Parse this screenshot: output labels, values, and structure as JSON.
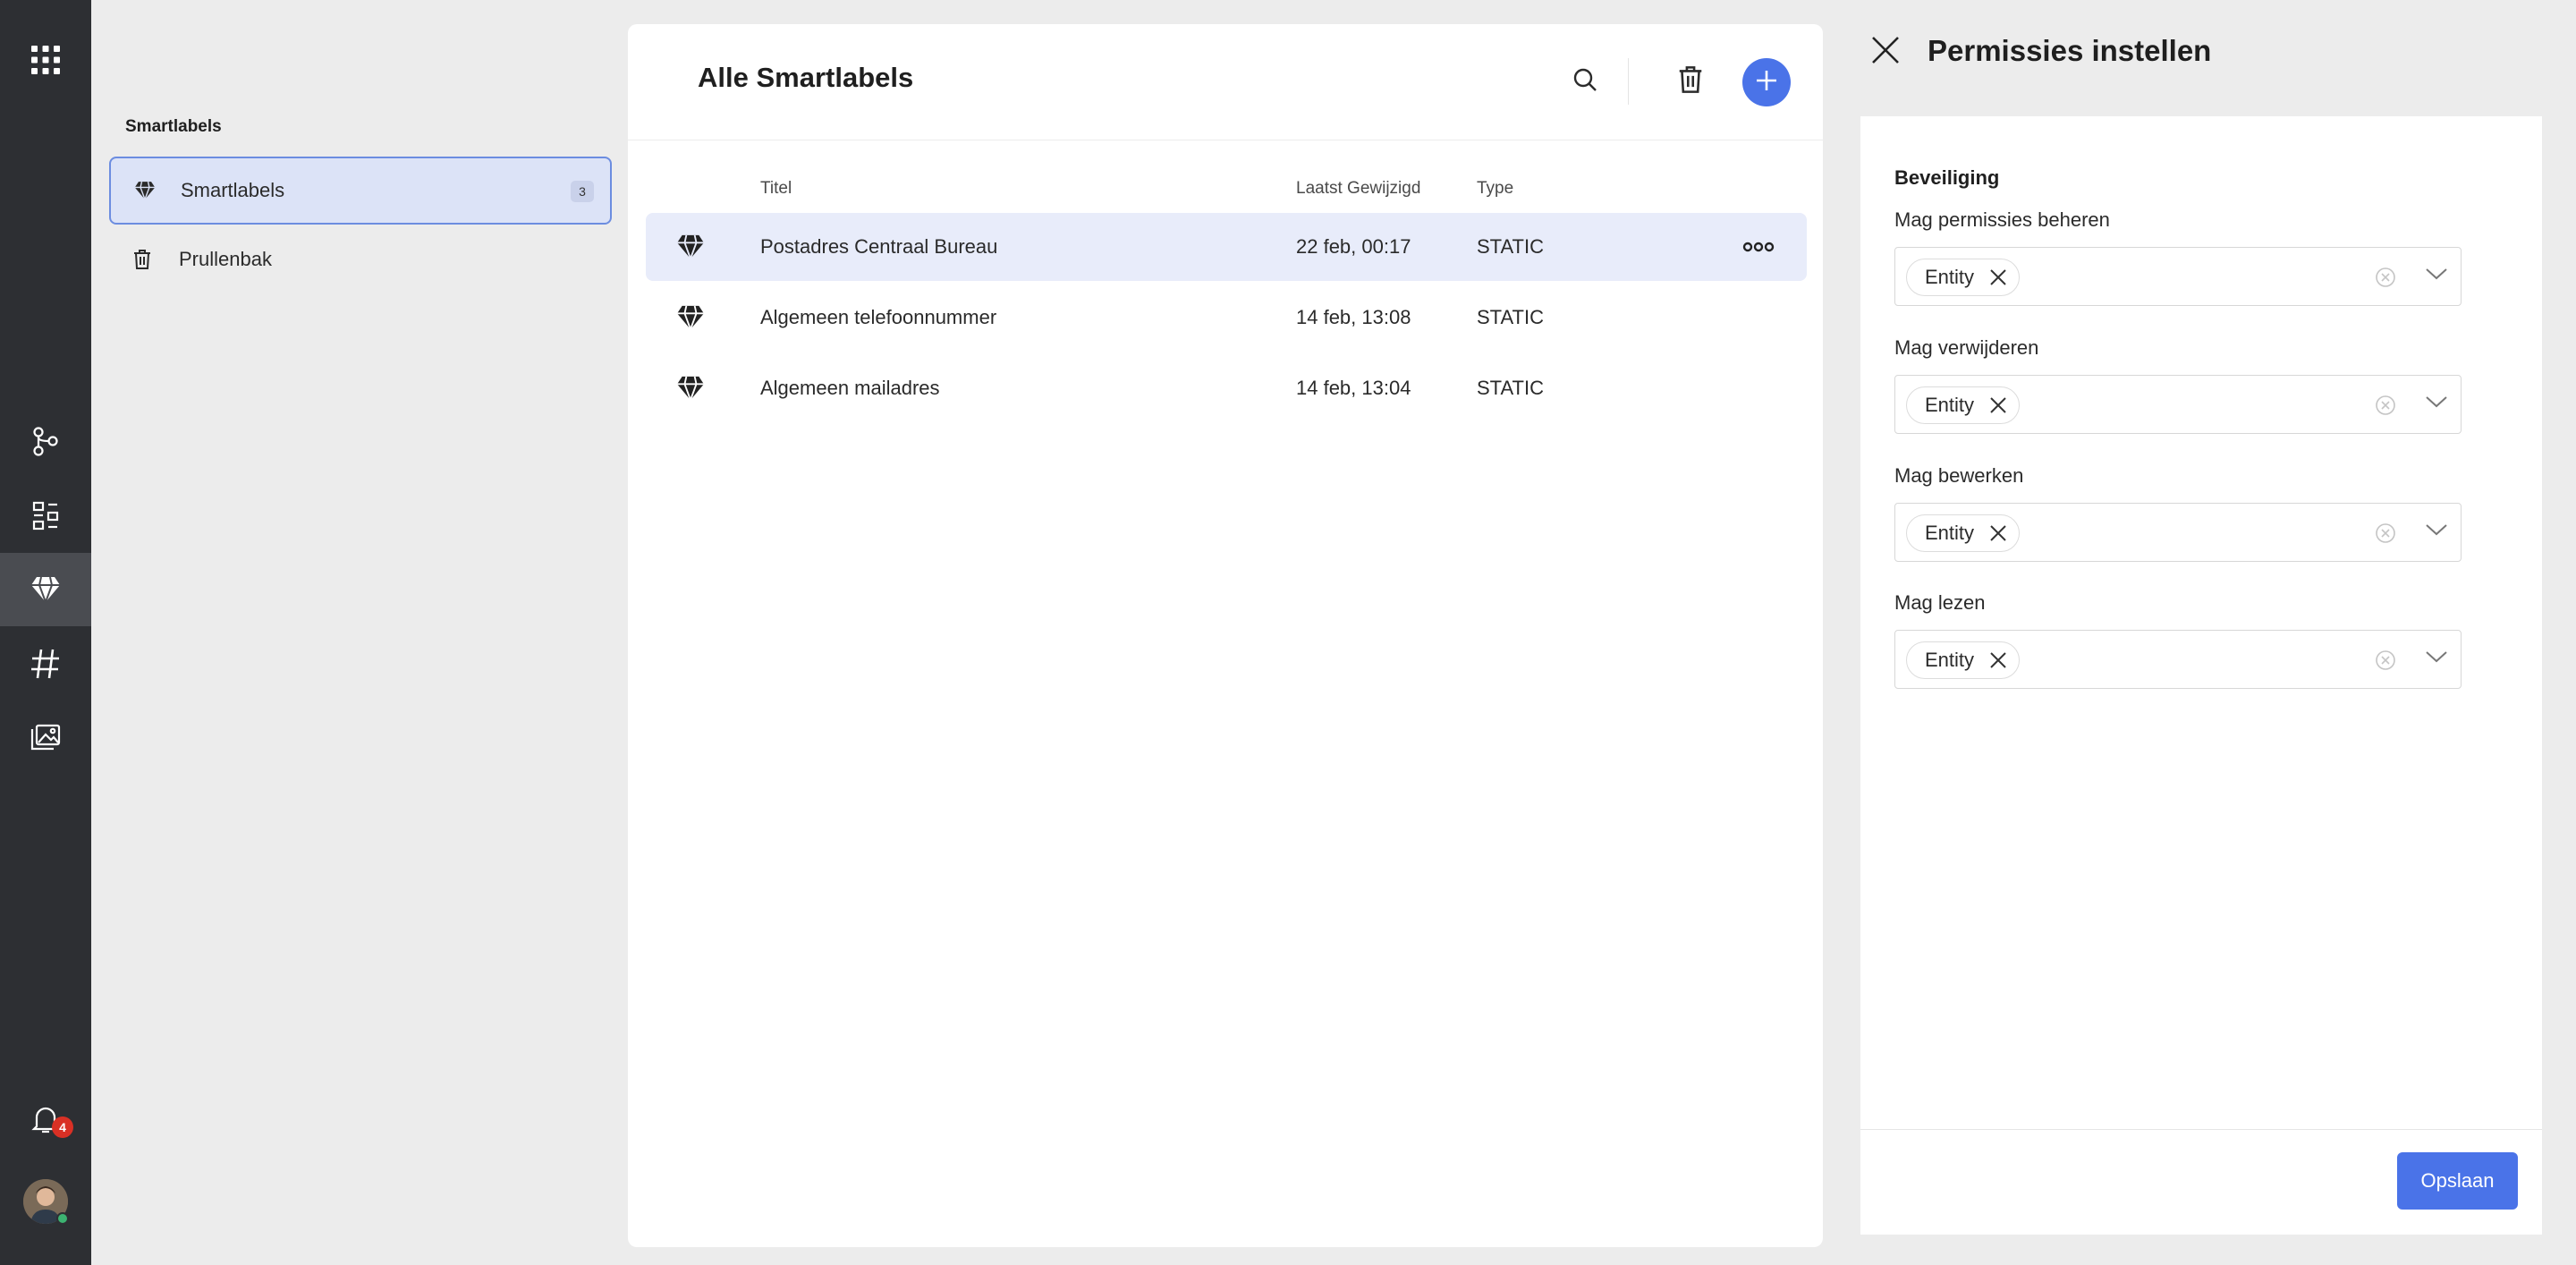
{
  "rail": {
    "icons": [
      "apps-grid-icon",
      "branch-icon",
      "layout-icon",
      "smartlabel-diamond-icon",
      "hashtag-icon",
      "media-folder-icon",
      "bell-icon"
    ],
    "notifications_count": "4"
  },
  "sidebar": {
    "title": "Smartlabels",
    "items": [
      {
        "label": "Smartlabels",
        "count": "3",
        "icon": "diamond-icon",
        "active": true
      },
      {
        "label": "Prullenbak",
        "icon": "trash-icon"
      }
    ]
  },
  "main": {
    "title": "Alle Smartlabels",
    "columns": [
      "Titel",
      "Laatst Gewijzigd",
      "Type"
    ],
    "rows": [
      {
        "title": "Postadres Centraal Bureau",
        "modified": "22 feb, 00:17",
        "type": "STATIC",
        "selected": true
      },
      {
        "title": "Algemeen telefoonnummer",
        "modified": "14 feb, 13:08",
        "type": "STATIC"
      },
      {
        "title": "Algemeen mailadres",
        "modified": "14 feb, 13:04",
        "type": "STATIC"
      }
    ]
  },
  "panel": {
    "title": "Permissies instellen",
    "section": "Beveiliging",
    "fields": [
      {
        "label": "Mag permissies beheren",
        "chip": "Entity"
      },
      {
        "label": "Mag verwijderen",
        "chip": "Entity"
      },
      {
        "label": "Mag bewerken",
        "chip": "Entity"
      },
      {
        "label": "Mag lezen",
        "chip": "Entity"
      }
    ],
    "save_label": "Opslaan"
  },
  "colors": {
    "rail": "#2d2f33",
    "accent": "#4a73e8",
    "selection": "#e8ecfa",
    "badge": "#d93025"
  }
}
